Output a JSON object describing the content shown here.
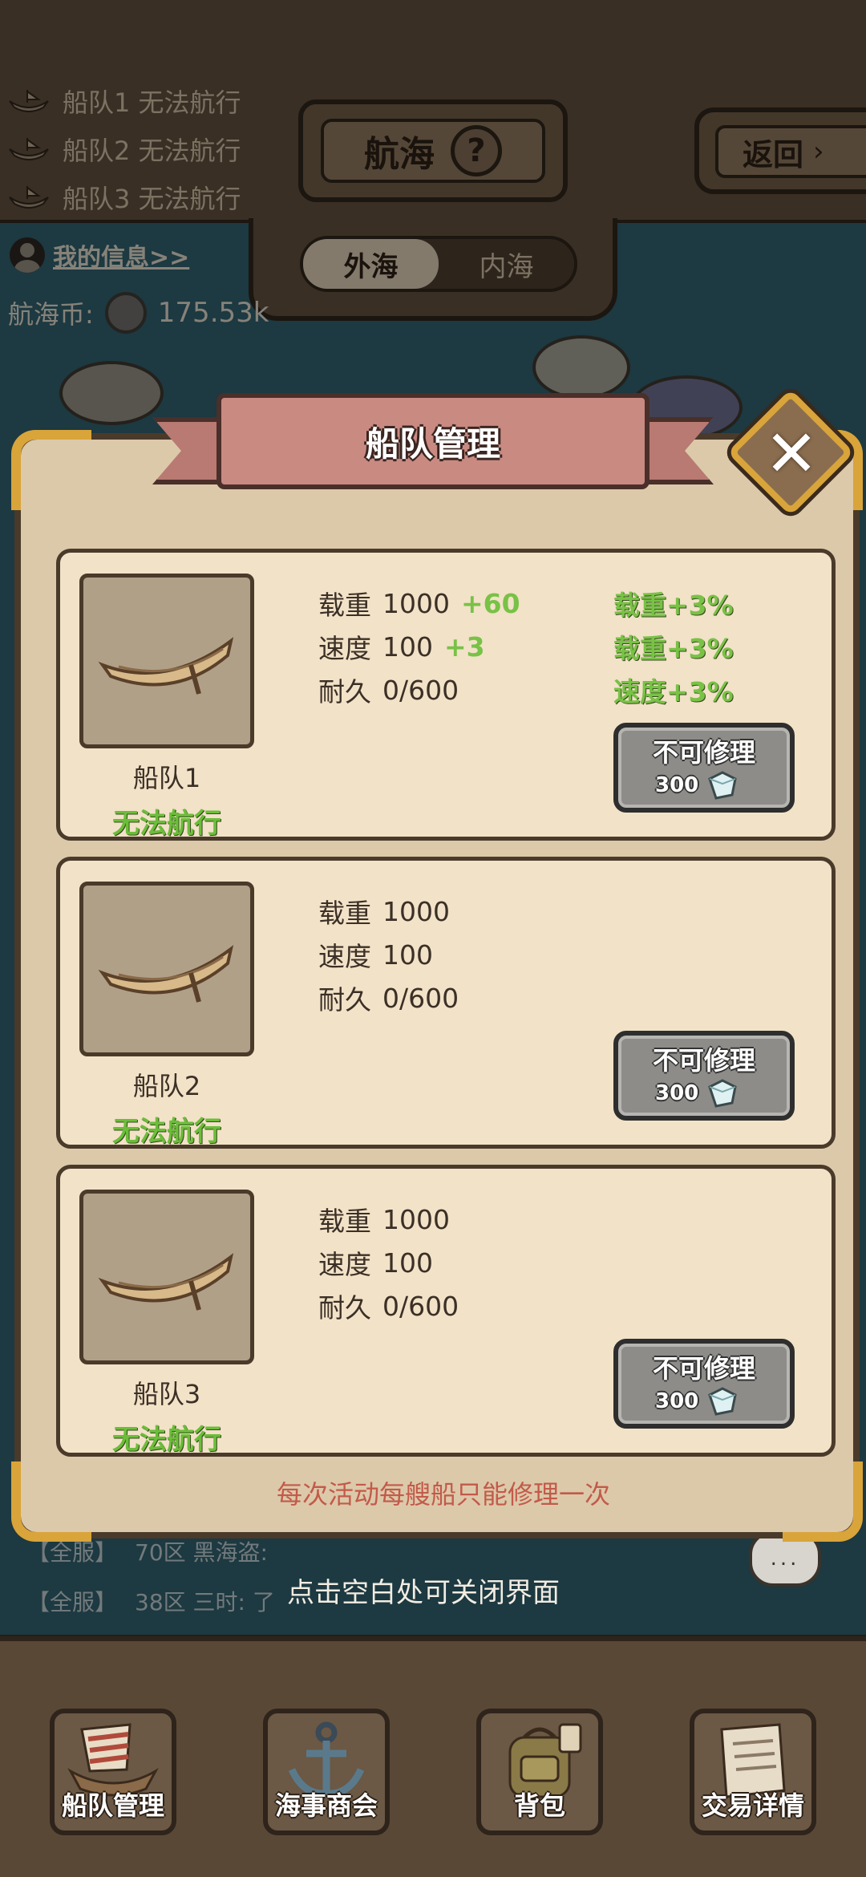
{
  "header": {
    "fleet_status": [
      {
        "label": "船队1 无法航行"
      },
      {
        "label": "船队2 无法航行"
      },
      {
        "label": "船队3 无法航行"
      }
    ],
    "title": "航海",
    "help_symbol": "?",
    "back_label": "返回",
    "back_arrow": "›"
  },
  "sea_tabs": [
    {
      "label": "外海",
      "active": true
    },
    {
      "label": "内海",
      "active": false
    }
  ],
  "user": {
    "info_link": "我的信息>>",
    "coin_label": "航海币:",
    "coin_value": "175.53k"
  },
  "modal": {
    "title": "船队管理",
    "close_symbol": "✕",
    "note": "每次活动每艘船只能修理一次",
    "fleets": [
      {
        "name": "船队1",
        "state": "无法航行",
        "stats": [
          {
            "label": "载重",
            "value": "1000",
            "bonus": "+60"
          },
          {
            "label": "速度",
            "value": "100",
            "bonus": "+3"
          },
          {
            "label": "耐久",
            "value": "0/600",
            "bonus": ""
          }
        ],
        "buffs": [
          "载重+3%",
          "载重+3%",
          "速度+3%"
        ],
        "repair_label": "不可修理",
        "repair_cost": "300"
      },
      {
        "name": "船队2",
        "state": "无法航行",
        "stats": [
          {
            "label": "载重",
            "value": "1000",
            "bonus": ""
          },
          {
            "label": "速度",
            "value": "100",
            "bonus": ""
          },
          {
            "label": "耐久",
            "value": "0/600",
            "bonus": ""
          }
        ],
        "buffs": [],
        "repair_label": "不可修理",
        "repair_cost": "300"
      },
      {
        "name": "船队3",
        "state": "无法航行",
        "stats": [
          {
            "label": "载重",
            "value": "1000",
            "bonus": ""
          },
          {
            "label": "速度",
            "value": "100",
            "bonus": ""
          },
          {
            "label": "耐久",
            "value": "0/600",
            "bonus": ""
          }
        ],
        "buffs": [],
        "repair_label": "不可修理",
        "repair_cost": "300"
      }
    ]
  },
  "chat": [
    {
      "channel": "【全服】",
      "text": "70区 黑海盗:"
    },
    {
      "channel": "【全服】",
      "text": "38区 三时: 了"
    }
  ],
  "close_hint": "点击空白处可关闭界面",
  "chat_bubble": "...",
  "bottom_nav": [
    {
      "label": "船队管理",
      "icon": "ship-icon"
    },
    {
      "label": "海事商会",
      "icon": "anchor-icon"
    },
    {
      "label": "背包",
      "icon": "backpack-icon"
    },
    {
      "label": "交易详情",
      "icon": "scroll-icon"
    }
  ],
  "colors": {
    "accent_green": "#78c246",
    "warning_red": "#c35a4a",
    "gold_trim": "#d9a43a"
  }
}
